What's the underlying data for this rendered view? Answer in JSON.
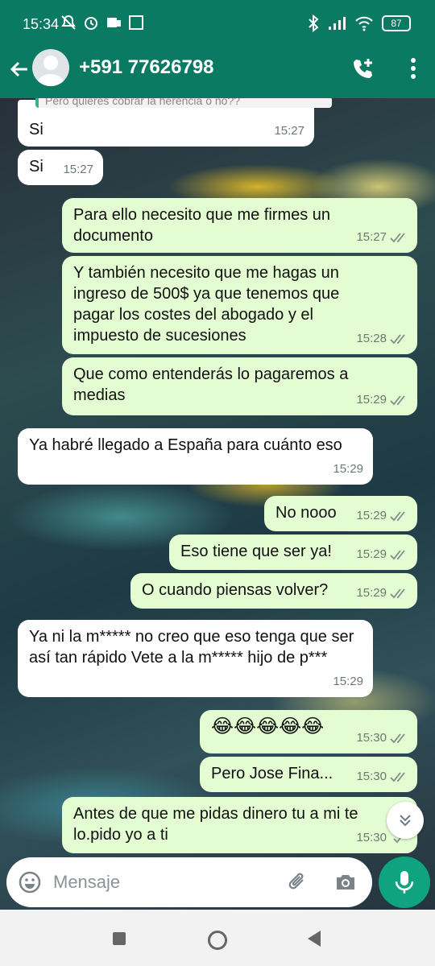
{
  "status_bar": {
    "time": "15:34",
    "battery": "87"
  },
  "header": {
    "contact": "+591 77626798"
  },
  "quoted_preview": "Pero quieres cobrar la herencia o no??",
  "messages": [
    {
      "dir": "in",
      "text": "Si",
      "time": "15:27"
    },
    {
      "dir": "in",
      "text": "Si",
      "time": "15:27"
    },
    {
      "dir": "out",
      "text": "Para ello necesito que me firmes un documento",
      "time": "15:27"
    },
    {
      "dir": "out",
      "text": "Y también necesito que me hagas un ingreso de 500$ ya que tenemos que pagar los costes del abogado y el impuesto de sucesiones",
      "time": "15:28"
    },
    {
      "dir": "out",
      "text": "Que como entenderás lo pagaremos a medias",
      "time": "15:29"
    },
    {
      "dir": "in",
      "text": "Ya habré llegado a España para cuánto eso",
      "time": "15:29"
    },
    {
      "dir": "out",
      "text": "No nooo",
      "time": "15:29"
    },
    {
      "dir": "out",
      "text": "Eso tiene que ser ya!",
      "time": "15:29"
    },
    {
      "dir": "out",
      "text": "O cuando piensas volver?",
      "time": "15:29"
    },
    {
      "dir": "in",
      "text": "Ya ni la m***** no creo que eso tenga que ser así tan rápido Vete a la m***** hijo de p***",
      "time": "15:29"
    },
    {
      "dir": "out",
      "text": "😂😂😂😂😂",
      "time": "15:30"
    },
    {
      "dir": "out",
      "text": "Pero Jose Fina...",
      "time": "15:30"
    },
    {
      "dir": "out",
      "text": "Antes de que me pidas dinero tu a mi te lo.pido yo a ti",
      "time": "15:30"
    }
  ],
  "input": {
    "placeholder": "Mensaje"
  },
  "icons": {
    "back": "arrow-left-icon",
    "add_call": "phone-plus-icon",
    "menu": "more-vertical-icon",
    "emoji": "emoji-icon",
    "attach": "paperclip-icon",
    "camera": "camera-icon",
    "mic": "microphone-icon",
    "scroll": "chevron-double-down-icon"
  },
  "colors": {
    "header": "#0b7a63",
    "outgoing": "#e3fcd2",
    "incoming": "#ffffff",
    "mic": "#0fa37f"
  }
}
